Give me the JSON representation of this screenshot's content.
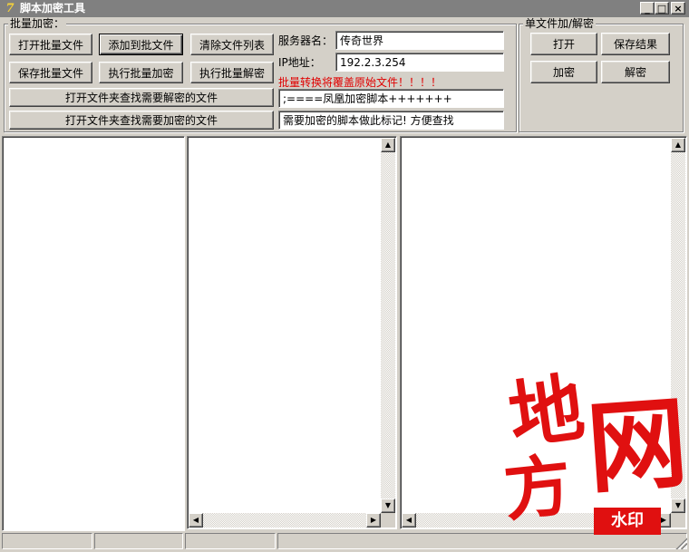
{
  "window": {
    "title": "脚本加密工具",
    "app_icon_glyph": "7",
    "minimize_glyph": "_",
    "maximize_glyph": "□",
    "close_glyph": "×"
  },
  "batch": {
    "group_label": "批量加密：",
    "open_batch_label": "打开批量文件",
    "add_to_batch_label": "添加到批文件",
    "clear_list_label": "清除文件列表",
    "save_batch_label": "保存批量文件",
    "run_encrypt_label": "执行批量加密",
    "run_decrypt_label": "执行批量解密",
    "find_decrypt_label": "打开文件夹查找需要解密的文件",
    "find_encrypt_label": "打开文件夹查找需要加密的文件"
  },
  "server": {
    "name_label": "服务器名：",
    "name_value": "传奇世界",
    "ip_label": "IP地址：",
    "ip_value": "192.2.3.254",
    "warning": "批量转换将覆盖原始文件！！！！",
    "marker_value": ";====凤凰加密脚本+++++++",
    "hint_value": "需要加密的脚本做此标记! 方便查找"
  },
  "single": {
    "group_label": "单文件加/解密",
    "open_label": "打开",
    "save_result_label": "保存结果",
    "encrypt_label": "加密",
    "decrypt_label": "解密"
  },
  "scroll_glyphs": {
    "up": "▲",
    "down": "▼",
    "left": "◀",
    "right": "▶"
  },
  "watermark": {
    "chars": [
      "地",
      "方",
      "网"
    ],
    "badge": "水印"
  },
  "colors": {
    "title_bar": "#808080",
    "warning": "#e00000",
    "face": "#d4d0c8",
    "watermark": "#e01010"
  }
}
